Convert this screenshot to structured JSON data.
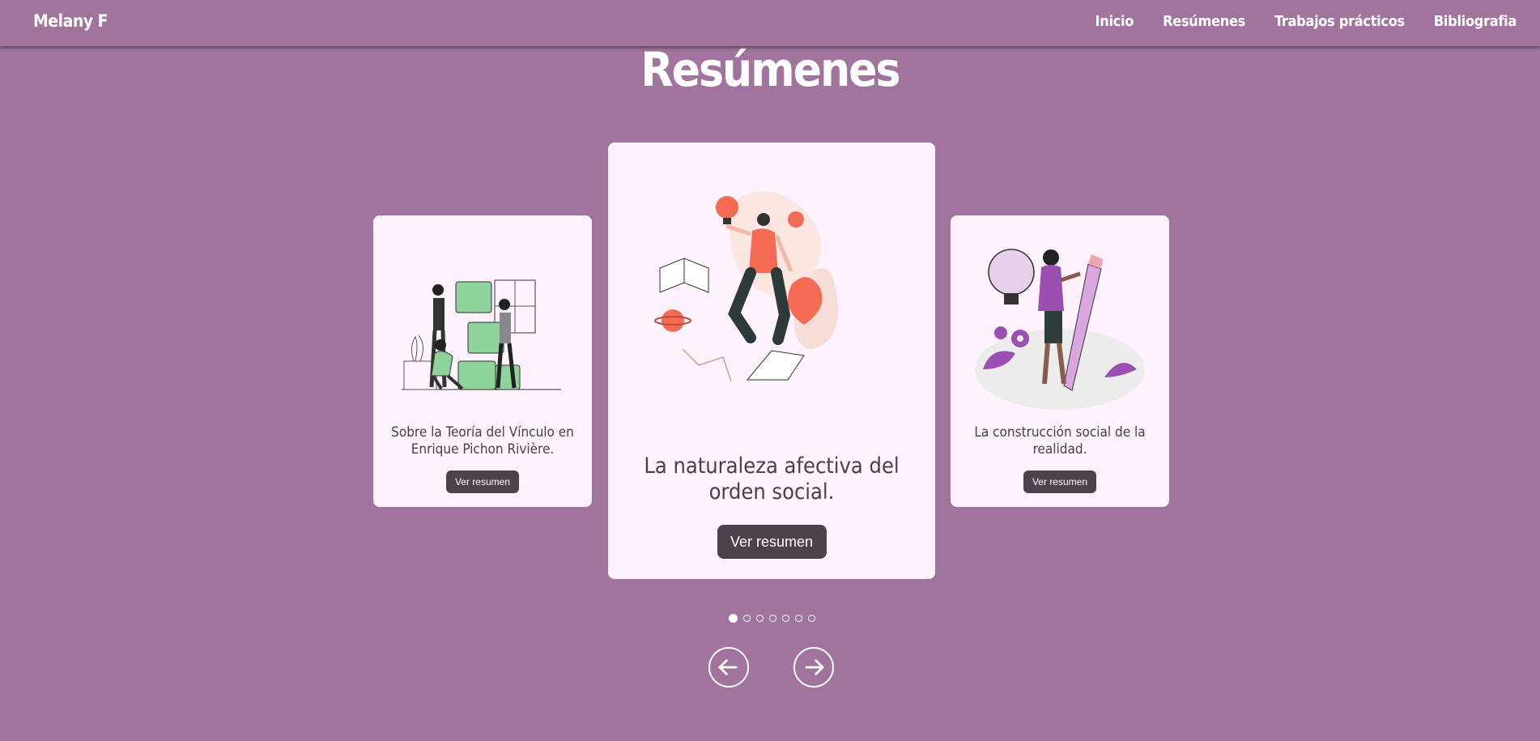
{
  "header": {
    "brand": "Melany F",
    "nav": [
      "Inicio",
      "Resúmenes",
      "Trabajos prácticos",
      "Bibliografia"
    ]
  },
  "page_title": "Resúmenes",
  "carousel": {
    "cards": [
      {
        "title": "Sobre la Teoría del Vínculo en Enrique Pichon Rivière.",
        "button": "Ver resumen",
        "icon": "teamwork-boxes-illustration"
      },
      {
        "title": "La naturaleza afectiva del orden social.",
        "button": "Ver resumen",
        "icon": "creative-person-lightbulbs-illustration"
      },
      {
        "title": "La construcción social de la realidad.",
        "button": "Ver resumen",
        "icon": "woman-with-pencil-illustration"
      }
    ],
    "dot_count": 7,
    "active_dot": 0,
    "prev_icon": "arrow-left-icon",
    "next_icon": "arrow-right-icon"
  },
  "colors": {
    "background": "#a0749d",
    "card": "#fdf2fd",
    "button": "#4d414b",
    "text_dark": "#4a3e47"
  }
}
